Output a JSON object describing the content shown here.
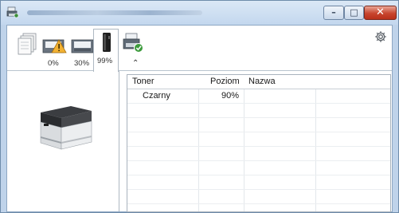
{
  "window": {
    "buttons": {
      "minimize": "–",
      "maximize": "□",
      "close": "✕"
    }
  },
  "toolbar": {
    "tabs": [
      {
        "label": "",
        "icon": "documents-icon"
      },
      {
        "label": "0%",
        "icon": "paper-tray-warning-icon"
      },
      {
        "label": "30%",
        "icon": "paper-tray-icon"
      },
      {
        "label": "99%",
        "icon": "toner-cartridge-icon",
        "active": true
      },
      {
        "label": "",
        "icon": "printer-ready-icon"
      }
    ],
    "collapse_glyph": "⌃",
    "settings_icon": "gear-icon"
  },
  "status_table": {
    "columns": [
      "Toner",
      "Poziom",
      "Nazwa"
    ],
    "rows": [
      {
        "toner": "Czarny",
        "poziom": "90%",
        "nazwa": ""
      }
    ]
  },
  "colors": {
    "frame": "#bfd3ea",
    "close_button": "#c8452e",
    "warning": "#f2b233"
  }
}
